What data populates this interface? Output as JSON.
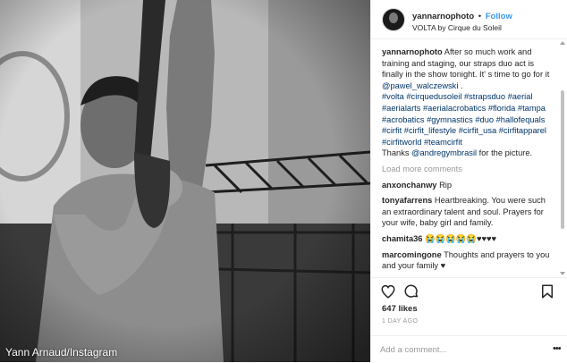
{
  "photo": {
    "credit": "Yann Arnaud/Instagram"
  },
  "header": {
    "username": "yannarnophoto",
    "separator": "•",
    "follow_label": "Follow",
    "location": "VOLTA by Cirque du Soleil"
  },
  "caption": {
    "username": "yannarnophoto",
    "text_before_mention": " After so much work and training and staging, our straps duo act is finally in the show tonight. It' s time to go for it ",
    "mention": "@pawel_walczewski",
    "text_after_mention": " .",
    "hashtags": "#volta #cirquedusoleil #strapsduo #aerial #aerialarts #aerialacrobatics #florida #tampa #acrobatics #gymnastics #duo #hallofequals #cirfit #cirfit_lifestyle #cirfit_usa #cirfitapparel #cirfitworld #teamcirfit",
    "thanks_prefix": "Thanks ",
    "thanks_mention": "@andregymbrasil",
    "thanks_suffix": " for the picture."
  },
  "load_more_label": "Load more comments",
  "comments": [
    {
      "user": "anxonchanwy",
      "text": "Rip"
    },
    {
      "user": "tonyafarrens",
      "text": "Heartbreaking. You were such an extraordinary talent and soul. Prayers for your wife, baby girl and family."
    },
    {
      "user": "chamita36",
      "text": "😭😭😭😭😭♥♥♥♥"
    },
    {
      "user": "marcomingone",
      "text": "Thoughts and prayers to you and your family ♥"
    }
  ],
  "likes": "647 likes",
  "time": "1 DAY AGO",
  "add_comment": {
    "placeholder": "Add a comment...",
    "more_label": "•••"
  },
  "icons": {
    "like": "heart-icon",
    "comment": "comment-bubble-icon",
    "save": "bookmark-icon",
    "more": "more-dots-icon"
  }
}
